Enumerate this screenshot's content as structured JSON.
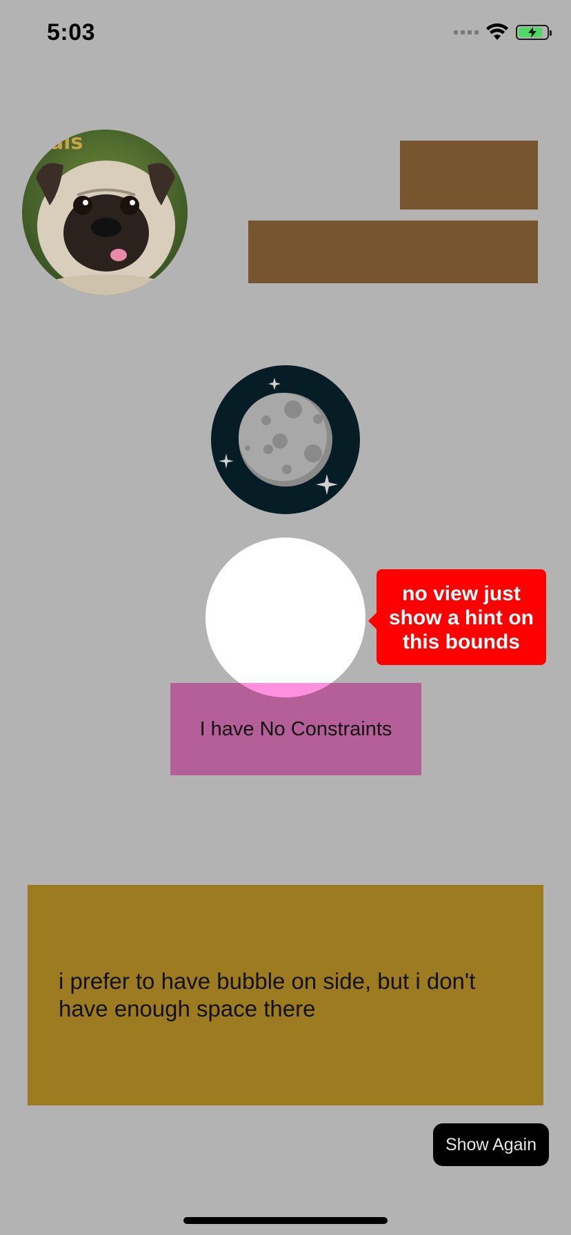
{
  "status_bar": {
    "time": "5:03",
    "battery_level": 0.85,
    "battery_color": "#4cd964"
  },
  "avatar": {
    "icon": "pug-dog-photo",
    "description_label": ""
  },
  "moon": {
    "icon": "moon-icon"
  },
  "tooltip": {
    "text": "no view just show a hint on this bounds",
    "color": "#ff0000"
  },
  "no_constraints": {
    "label": "I have No Constraints",
    "color": "#b45f97"
  },
  "bubble_side": {
    "text": "i prefer to have bubble on side, but i don't have enough space there",
    "color": "#9c7b21"
  },
  "actions": {
    "show_again_label": "Show Again"
  },
  "colors": {
    "background": "#b3b3b3",
    "brown": "#76552f",
    "highlight": "#ffffff"
  }
}
